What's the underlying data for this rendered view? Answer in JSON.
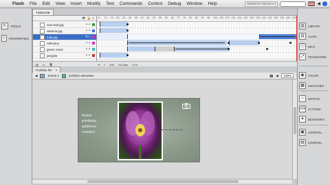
{
  "menubar": {
    "app_name": "Flash",
    "items": [
      "File",
      "Edit",
      "View",
      "Insert",
      "Modify",
      "Text",
      "Commands",
      "Control",
      "Debug",
      "Window",
      "Help"
    ],
    "workspace": "WEBSITE DESIGN ▾",
    "search_placeholder": ""
  },
  "left_panel": {
    "items": [
      {
        "label": "TOOLS",
        "icon": "tools-icon"
      },
      {
        "label": "PROPERTIES",
        "icon": "properties-icon"
      }
    ]
  },
  "right_panel": {
    "items": [
      {
        "label": "LIBRARY",
        "icon": "library-icon"
      },
      {
        "label": "ALIGN",
        "icon": "align-icon"
      },
      {
        "label": "INFO",
        "icon": "info-icon"
      },
      {
        "label": "TRANSFORM",
        "icon": "transform-icon"
      },
      {
        "label": "COLOR",
        "icon": "color-icon"
      },
      {
        "label": "SWATCHES",
        "icon": "swatches-icon"
      },
      {
        "label": "MOTION",
        "icon": "motion-icon"
      },
      {
        "label": "ACTIONS",
        "icon": "actions-icon"
      },
      {
        "label": "BEHAVIORS",
        "icon": "behaviors-icon"
      },
      {
        "label": "COMPON...",
        "icon": "components-icon"
      },
      {
        "label": "COMPON...",
        "icon": "component-inspector-icon"
      }
    ]
  },
  "timeline": {
    "tab_label": "TIMELINE",
    "layers": [
      {
        "name": "nine-leaf.jpg",
        "color": "#3c9c3c",
        "selected": false
      },
      {
        "name": "wisteria.jpg",
        "color": "#3d6ce0",
        "selected": false
      },
      {
        "name": "tulip.jpg",
        "color": "#cc33cc",
        "selected": true
      },
      {
        "name": "reflection",
        "color": "#cc33cc",
        "selected": false
      },
      {
        "name": "green roses",
        "color": "#36b7b7",
        "selected": false
      },
      {
        "name": "pergola",
        "color": "#cc3333",
        "selected": false
      }
    ],
    "ruler_marks": [
      "5",
      "10",
      "15",
      "20",
      "25",
      "30",
      "35",
      "40",
      "45",
      "50",
      "55",
      "60",
      "65",
      "70",
      "75",
      "80",
      "85",
      "90",
      "95",
      "100",
      "105",
      "110",
      "115",
      "120",
      "125",
      "130",
      "135",
      "140",
      "145",
      "150",
      "155",
      "160",
      "165"
    ],
    "footer": {
      "current_frame": "100",
      "fps": "24.0 fps",
      "time": "4.1s"
    }
  },
  "document": {
    "tab_label": "Portfolio.fla*",
    "breadcrumb_scene": "Scene 1",
    "breadcrumb_symbol": "portfolio animation",
    "zoom": "100%"
  },
  "stage": {
    "nav_links": [
      "home",
      "portfolio",
      "address",
      "contact"
    ]
  }
}
